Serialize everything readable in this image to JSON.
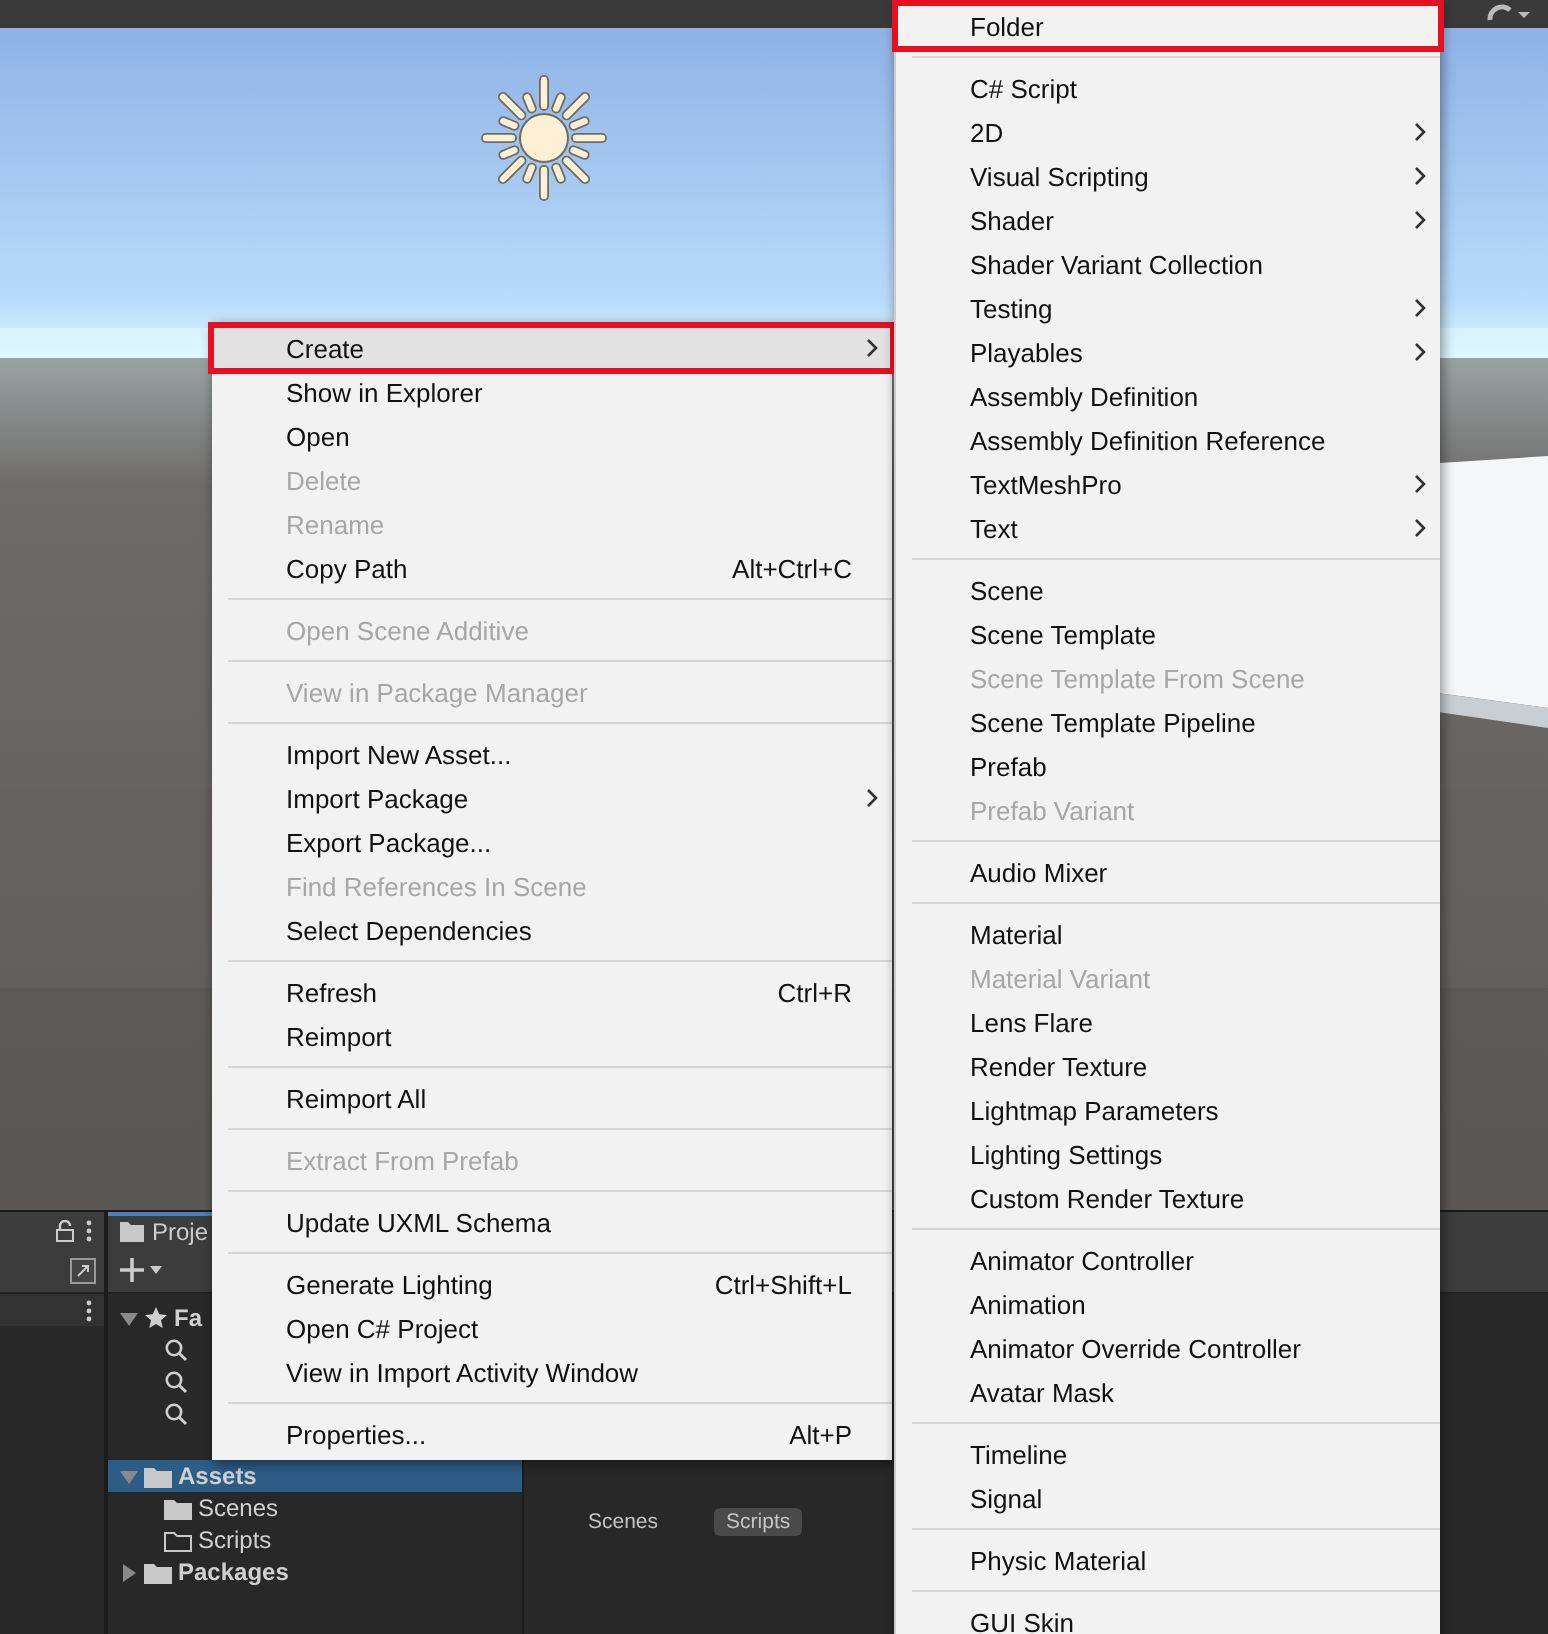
{
  "project_panel": {
    "tab": "Proje",
    "tree": [
      {
        "label": "Fa",
        "kind": "favorites",
        "expanded": true,
        "selected": false,
        "children": [
          {
            "kind": "search"
          },
          {
            "kind": "search"
          },
          {
            "kind": "search"
          }
        ]
      },
      {
        "label": "Assets",
        "kind": "folder",
        "expanded": true,
        "selected": true,
        "children": [
          {
            "label": "Scenes",
            "kind": "folder",
            "selected": false
          },
          {
            "label": "Scripts",
            "kind": "empty-folder",
            "selected": false
          }
        ]
      },
      {
        "label": "Packages",
        "kind": "folder",
        "expanded": false,
        "selected": false
      }
    ],
    "items": [
      {
        "label": "Scenes",
        "selected": false
      },
      {
        "label": "Scripts",
        "selected": true
      }
    ]
  },
  "context_menu": {
    "sections": [
      [
        {
          "label": "Create",
          "submenu": true,
          "disabled": false,
          "highlighted": true,
          "outlined": true
        },
        {
          "label": "Show in Explorer",
          "submenu": false,
          "disabled": false,
          "highlighted": false,
          "outlined": false
        },
        {
          "label": "Open",
          "submenu": false,
          "disabled": false,
          "highlighted": false,
          "outlined": false
        },
        {
          "label": "Delete",
          "submenu": false,
          "disabled": true,
          "highlighted": false,
          "outlined": false
        },
        {
          "label": "Rename",
          "submenu": false,
          "disabled": true,
          "highlighted": false,
          "outlined": false
        },
        {
          "label": "Copy Path",
          "shortcut": "Alt+Ctrl+C",
          "submenu": false,
          "disabled": false,
          "highlighted": false,
          "outlined": false
        }
      ],
      [
        {
          "label": "Open Scene Additive",
          "submenu": false,
          "disabled": true,
          "highlighted": false,
          "outlined": false
        }
      ],
      [
        {
          "label": "View in Package Manager",
          "submenu": false,
          "disabled": true,
          "highlighted": false,
          "outlined": false
        }
      ],
      [
        {
          "label": "Import New Asset...",
          "submenu": false,
          "disabled": false,
          "highlighted": false,
          "outlined": false
        },
        {
          "label": "Import Package",
          "submenu": true,
          "disabled": false,
          "highlighted": false,
          "outlined": false
        },
        {
          "label": "Export Package...",
          "submenu": false,
          "disabled": false,
          "highlighted": false,
          "outlined": false
        },
        {
          "label": "Find References In Scene",
          "submenu": false,
          "disabled": true,
          "highlighted": false,
          "outlined": false
        },
        {
          "label": "Select Dependencies",
          "submenu": false,
          "disabled": false,
          "highlighted": false,
          "outlined": false
        }
      ],
      [
        {
          "label": "Refresh",
          "shortcut": "Ctrl+R",
          "submenu": false,
          "disabled": false,
          "highlighted": false,
          "outlined": false
        },
        {
          "label": "Reimport",
          "submenu": false,
          "disabled": false,
          "highlighted": false,
          "outlined": false
        }
      ],
      [
        {
          "label": "Reimport All",
          "submenu": false,
          "disabled": false,
          "highlighted": false,
          "outlined": false
        }
      ],
      [
        {
          "label": "Extract From Prefab",
          "submenu": false,
          "disabled": true,
          "highlighted": false,
          "outlined": false
        }
      ],
      [
        {
          "label": "Update UXML Schema",
          "submenu": false,
          "disabled": false,
          "highlighted": false,
          "outlined": false
        }
      ],
      [
        {
          "label": "Generate Lighting",
          "shortcut": "Ctrl+Shift+L",
          "submenu": false,
          "disabled": false,
          "highlighted": false,
          "outlined": false
        },
        {
          "label": "Open C# Project",
          "submenu": false,
          "disabled": false,
          "highlighted": false,
          "outlined": false
        },
        {
          "label": "View in Import Activity Window",
          "submenu": false,
          "disabled": false,
          "highlighted": false,
          "outlined": false
        }
      ],
      [
        {
          "label": "Properties...",
          "shortcut": "Alt+P",
          "submenu": false,
          "disabled": false,
          "highlighted": false,
          "outlined": false
        }
      ]
    ]
  },
  "create_submenu": {
    "sections": [
      [
        {
          "label": "Folder",
          "submenu": false,
          "disabled": false,
          "highlighted": false,
          "outlined": true
        }
      ],
      [
        {
          "label": "C# Script",
          "submenu": false,
          "disabled": false,
          "highlighted": false,
          "outlined": false
        },
        {
          "label": "2D",
          "submenu": true,
          "disabled": false,
          "highlighted": false,
          "outlined": false
        },
        {
          "label": "Visual Scripting",
          "submenu": true,
          "disabled": false,
          "highlighted": false,
          "outlined": false
        },
        {
          "label": "Shader",
          "submenu": true,
          "disabled": false,
          "highlighted": false,
          "outlined": false
        },
        {
          "label": "Shader Variant Collection",
          "submenu": false,
          "disabled": false,
          "highlighted": false,
          "outlined": false
        },
        {
          "label": "Testing",
          "submenu": true,
          "disabled": false,
          "highlighted": false,
          "outlined": false
        },
        {
          "label": "Playables",
          "submenu": true,
          "disabled": false,
          "highlighted": false,
          "outlined": false
        },
        {
          "label": "Assembly Definition",
          "submenu": false,
          "disabled": false,
          "highlighted": false,
          "outlined": false
        },
        {
          "label": "Assembly Definition Reference",
          "submenu": false,
          "disabled": false,
          "highlighted": false,
          "outlined": false
        },
        {
          "label": "TextMeshPro",
          "submenu": true,
          "disabled": false,
          "highlighted": false,
          "outlined": false
        },
        {
          "label": "Text",
          "submenu": true,
          "disabled": false,
          "highlighted": false,
          "outlined": false
        }
      ],
      [
        {
          "label": "Scene",
          "submenu": false,
          "disabled": false,
          "highlighted": false,
          "outlined": false
        },
        {
          "label": "Scene Template",
          "submenu": false,
          "disabled": false,
          "highlighted": false,
          "outlined": false
        },
        {
          "label": "Scene Template From Scene",
          "submenu": false,
          "disabled": true,
          "highlighted": false,
          "outlined": false
        },
        {
          "label": "Scene Template Pipeline",
          "submenu": false,
          "disabled": false,
          "highlighted": false,
          "outlined": false
        },
        {
          "label": "Prefab",
          "submenu": false,
          "disabled": false,
          "highlighted": false,
          "outlined": false
        },
        {
          "label": "Prefab Variant",
          "submenu": false,
          "disabled": true,
          "highlighted": false,
          "outlined": false
        }
      ],
      [
        {
          "label": "Audio Mixer",
          "submenu": false,
          "disabled": false,
          "highlighted": false,
          "outlined": false
        }
      ],
      [
        {
          "label": "Material",
          "submenu": false,
          "disabled": false,
          "highlighted": false,
          "outlined": false
        },
        {
          "label": "Material Variant",
          "submenu": false,
          "disabled": true,
          "highlighted": false,
          "outlined": false
        },
        {
          "label": "Lens Flare",
          "submenu": false,
          "disabled": false,
          "highlighted": false,
          "outlined": false
        },
        {
          "label": "Render Texture",
          "submenu": false,
          "disabled": false,
          "highlighted": false,
          "outlined": false
        },
        {
          "label": "Lightmap Parameters",
          "submenu": false,
          "disabled": false,
          "highlighted": false,
          "outlined": false
        },
        {
          "label": "Lighting Settings",
          "submenu": false,
          "disabled": false,
          "highlighted": false,
          "outlined": false
        },
        {
          "label": "Custom Render Texture",
          "submenu": false,
          "disabled": false,
          "highlighted": false,
          "outlined": false
        }
      ],
      [
        {
          "label": "Animator Controller",
          "submenu": false,
          "disabled": false,
          "highlighted": false,
          "outlined": false
        },
        {
          "label": "Animation",
          "submenu": false,
          "disabled": false,
          "highlighted": false,
          "outlined": false
        },
        {
          "label": "Animator Override Controller",
          "submenu": false,
          "disabled": false,
          "highlighted": false,
          "outlined": false
        },
        {
          "label": "Avatar Mask",
          "submenu": false,
          "disabled": false,
          "highlighted": false,
          "outlined": false
        }
      ],
      [
        {
          "label": "Timeline",
          "submenu": false,
          "disabled": false,
          "highlighted": false,
          "outlined": false
        },
        {
          "label": "Signal",
          "submenu": false,
          "disabled": false,
          "highlighted": false,
          "outlined": false
        }
      ],
      [
        {
          "label": "Physic Material",
          "submenu": false,
          "disabled": false,
          "highlighted": false,
          "outlined": false
        }
      ],
      [
        {
          "label": "GUI Skin",
          "submenu": false,
          "disabled": false,
          "highlighted": false,
          "outlined": false
        }
      ]
    ]
  }
}
